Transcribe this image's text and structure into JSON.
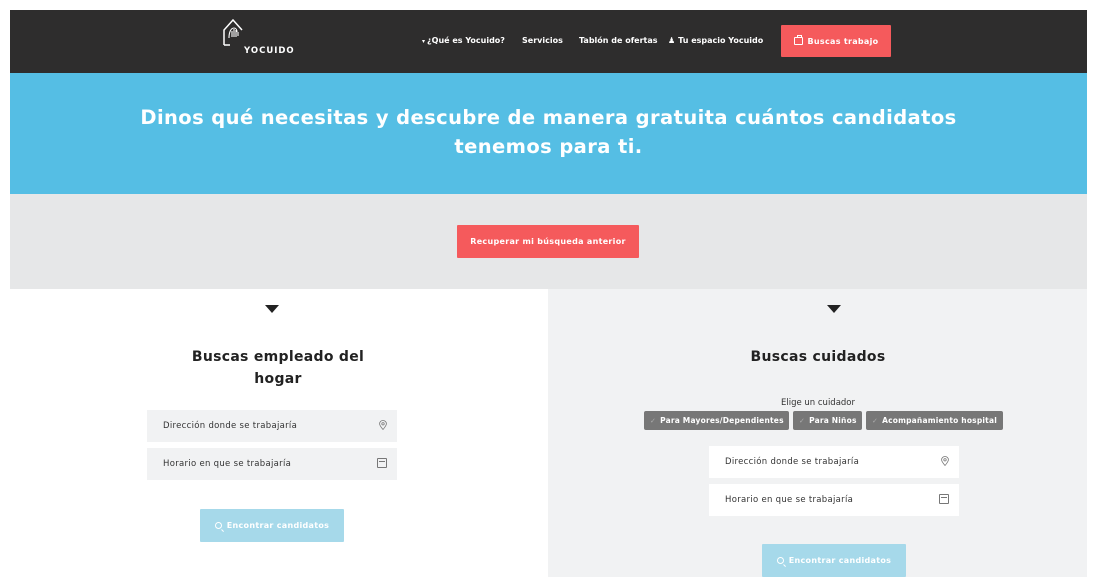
{
  "nav": {
    "brand": "YOCUIDO",
    "links": [
      "¿Qué es Yocuido?",
      "Servicios",
      "Tablón de ofertas",
      "Tu espacio Yocuido"
    ],
    "cta": "Buscas trabajo"
  },
  "hero": {
    "line1": "Dinos qué necesitas y descubre de manera gratuita cuántos candidatos",
    "line2": "tenemos para ti."
  },
  "recover": {
    "label": "Recuperar mi búsqueda anterior"
  },
  "left": {
    "title_line1": "Buscas empleado del",
    "title_line2": "hogar",
    "address_placeholder": "Dirección donde se trabajaría",
    "schedule_placeholder": "Horario en que se trabajaría",
    "find_label": "Encontrar candidatos"
  },
  "right": {
    "title": "Buscas cuidados",
    "choose_label": "Elige un cuidador",
    "chips": [
      "Para Mayores/Dependientes",
      "Para Niños",
      "Acompañamiento hospital"
    ],
    "address_placeholder": "Dirección donde se trabajaría",
    "schedule_placeholder": "Horario en que se trabajaría",
    "find_label": "Encontrar candidatos"
  },
  "colors": {
    "nav_bg": "#2e2d2d",
    "accent": "#f55a5c",
    "hero_bg": "#55bee4",
    "band_bg": "#e6e7e8",
    "find_btn": "#a6d9ea"
  }
}
